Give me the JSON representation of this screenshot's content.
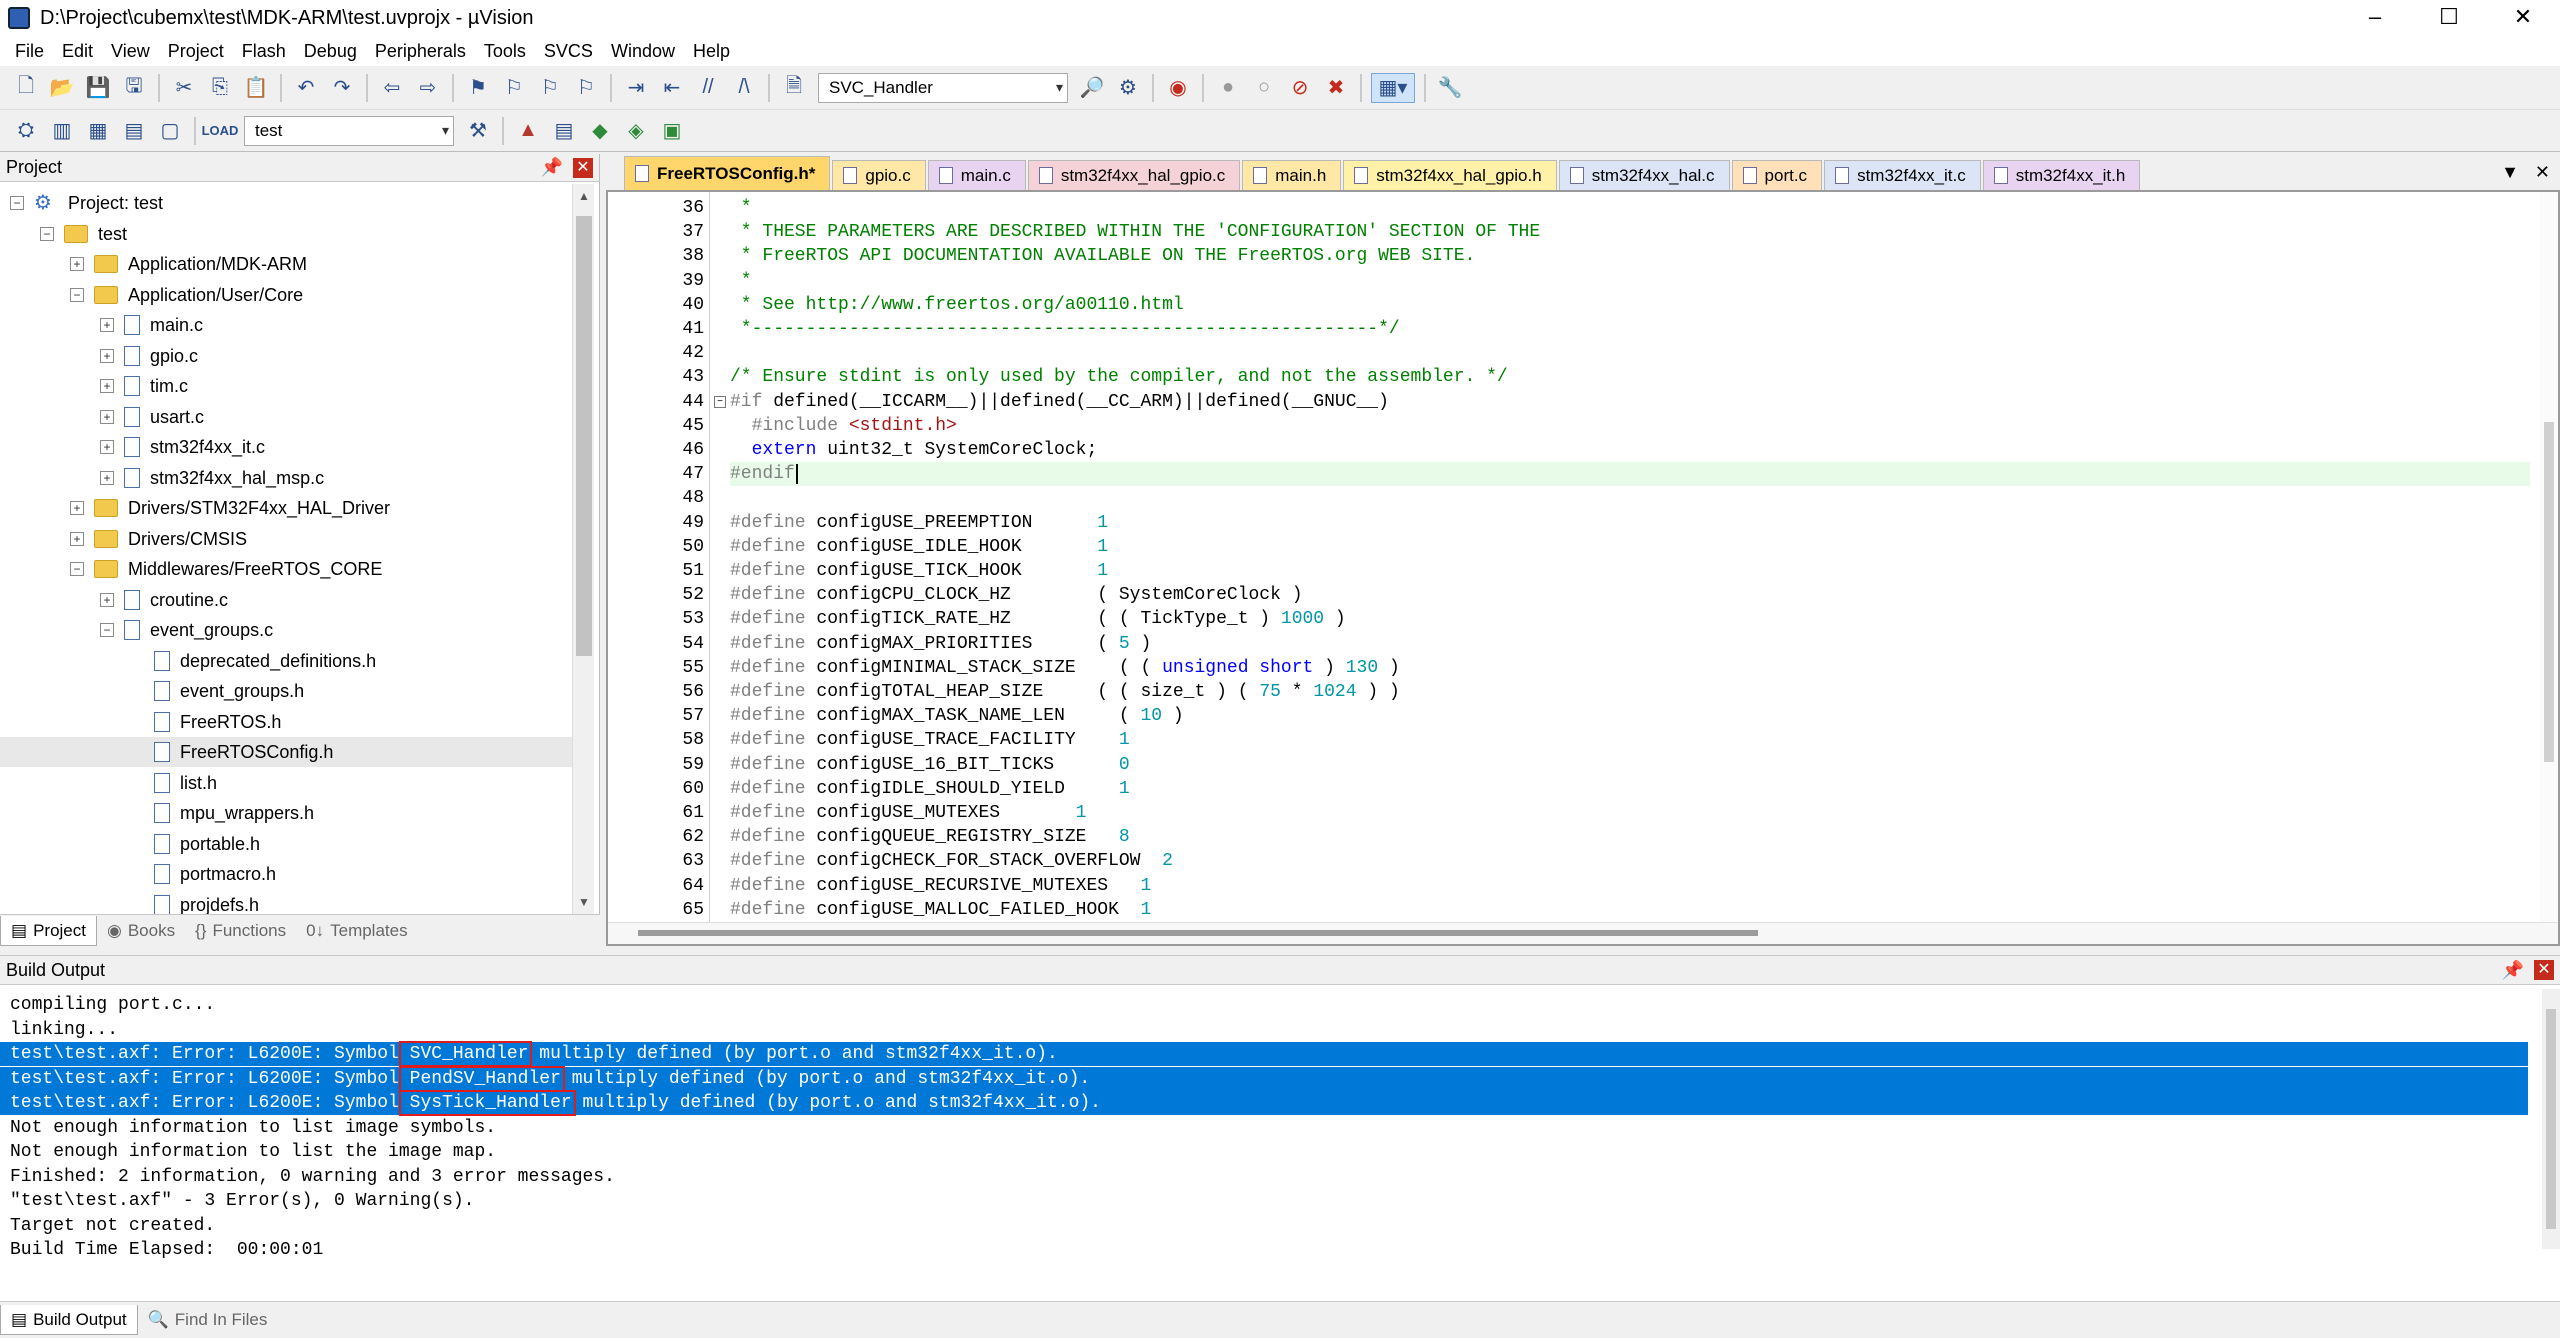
{
  "window": {
    "title": "D:\\Project\\cubemx\\test\\MDK-ARM\\test.uvprojx - µVision",
    "controls": [
      "–",
      "☐",
      "✕"
    ]
  },
  "menubar": [
    "File",
    "Edit",
    "View",
    "Project",
    "Flash",
    "Debug",
    "Peripherals",
    "Tools",
    "SVCS",
    "Window",
    "Help"
  ],
  "toolbar": {
    "function_combo": "SVC_Handler",
    "target_combo": "test"
  },
  "project_pane": {
    "title": "Project",
    "tree": [
      {
        "label": "Project: test",
        "level": 0,
        "toggle": "−",
        "icon": "project"
      },
      {
        "label": "test",
        "level": 1,
        "toggle": "−",
        "icon": "folder"
      },
      {
        "label": "Application/MDK-ARM",
        "level": 2,
        "toggle": "+",
        "icon": "folder"
      },
      {
        "label": "Application/User/Core",
        "level": 2,
        "toggle": "−",
        "icon": "folder"
      },
      {
        "label": "main.c",
        "level": 3,
        "toggle": "+",
        "icon": "file"
      },
      {
        "label": "gpio.c",
        "level": 3,
        "toggle": "+",
        "icon": "file"
      },
      {
        "label": "tim.c",
        "level": 3,
        "toggle": "+",
        "icon": "file"
      },
      {
        "label": "usart.c",
        "level": 3,
        "toggle": "+",
        "icon": "file"
      },
      {
        "label": "stm32f4xx_it.c",
        "level": 3,
        "toggle": "+",
        "icon": "file"
      },
      {
        "label": "stm32f4xx_hal_msp.c",
        "level": 3,
        "toggle": "+",
        "icon": "file"
      },
      {
        "label": "Drivers/STM32F4xx_HAL_Driver",
        "level": 2,
        "toggle": "+",
        "icon": "folder"
      },
      {
        "label": "Drivers/CMSIS",
        "level": 2,
        "toggle": "+",
        "icon": "folder"
      },
      {
        "label": "Middlewares/FreeRTOS_CORE",
        "level": 2,
        "toggle": "−",
        "icon": "folder"
      },
      {
        "label": "croutine.c",
        "level": 3,
        "toggle": "+",
        "icon": "file"
      },
      {
        "label": "event_groups.c",
        "level": 3,
        "toggle": "−",
        "icon": "file"
      },
      {
        "label": "deprecated_definitions.h",
        "level": 4,
        "toggle": "",
        "icon": "file"
      },
      {
        "label": "event_groups.h",
        "level": 4,
        "toggle": "",
        "icon": "file"
      },
      {
        "label": "FreeRTOS.h",
        "level": 4,
        "toggle": "",
        "icon": "file"
      },
      {
        "label": "FreeRTOSConfig.h",
        "level": 4,
        "toggle": "",
        "icon": "file",
        "selected": true
      },
      {
        "label": "list.h",
        "level": 4,
        "toggle": "",
        "icon": "file"
      },
      {
        "label": "mpu_wrappers.h",
        "level": 4,
        "toggle": "",
        "icon": "file"
      },
      {
        "label": "portable.h",
        "level": 4,
        "toggle": "",
        "icon": "file"
      },
      {
        "label": "portmacro.h",
        "level": 4,
        "toggle": "",
        "icon": "file"
      },
      {
        "label": "projdefs.h",
        "level": 4,
        "toggle": "",
        "icon": "file"
      }
    ],
    "tabs": [
      {
        "label": "Project",
        "icon": "▤"
      },
      {
        "label": "Books",
        "icon": "◉"
      },
      {
        "label": "Functions",
        "icon": "{}"
      },
      {
        "label": "Templates",
        "icon": "0↓"
      }
    ]
  },
  "editor": {
    "tabs": [
      {
        "label": "FreeRTOSConfig.h*",
        "color": "#ffd66b",
        "active": true
      },
      {
        "label": "gpio.c",
        "color": "#ffe7a6"
      },
      {
        "label": "main.c",
        "color": "#e8d4f0"
      },
      {
        "label": "stm32f4xx_hal_gpio.c",
        "color": "#f5d2d8"
      },
      {
        "label": "main.h",
        "color": "#ffe7a6"
      },
      {
        "label": "stm32f4xx_hal_gpio.h",
        "color": "#fff2a8"
      },
      {
        "label": "stm32f4xx_hal.c",
        "color": "#dbe5f5"
      },
      {
        "label": "port.c",
        "color": "#ffe0b8"
      },
      {
        "label": "stm32f4xx_it.c",
        "color": "#dbe5f5"
      },
      {
        "label": "stm32f4xx_it.h",
        "color": "#e8d4f0"
      }
    ],
    "lines": [
      {
        "n": "36",
        "t": [
          [
            "c-com",
            " *"
          ]
        ]
      },
      {
        "n": "37",
        "t": [
          [
            "c-com",
            " * THESE PARAMETERS ARE DESCRIBED WITHIN THE 'CONFIGURATION' SECTION OF THE"
          ]
        ]
      },
      {
        "n": "38",
        "t": [
          [
            "c-com",
            " * FreeRTOS API DOCUMENTATION AVAILABLE ON THE FreeRTOS.org WEB SITE."
          ]
        ]
      },
      {
        "n": "39",
        "t": [
          [
            "c-com",
            " *"
          ]
        ]
      },
      {
        "n": "40",
        "t": [
          [
            "c-com",
            " * See http://www.freertos.org/a00110.html"
          ]
        ]
      },
      {
        "n": "41",
        "t": [
          [
            "c-com",
            " *----------------------------------------------------------*/"
          ]
        ]
      },
      {
        "n": "42",
        "t": [
          [
            "c-txt",
            ""
          ]
        ]
      },
      {
        "n": "43",
        "t": [
          [
            "c-com",
            "/* Ensure stdint is only used by the compiler, and not the assembler. */"
          ]
        ]
      },
      {
        "n": "44",
        "t": [
          [
            "c-pp",
            "#if"
          ],
          [
            "c-txt",
            " defined(__ICCARM__)||defined(__CC_ARM)||defined(__GNUC__)"
          ]
        ],
        "fold": true
      },
      {
        "n": "45",
        "t": [
          [
            "c-pp",
            "  #include "
          ],
          [
            "c-str",
            "<stdint.h>"
          ]
        ]
      },
      {
        "n": "46",
        "t": [
          [
            "c-kw",
            "  extern"
          ],
          [
            "c-txt",
            " uint32_t SystemCoreClock;"
          ]
        ]
      },
      {
        "n": "47",
        "t": [
          [
            "c-pp",
            "#endif"
          ]
        ],
        "current": true
      },
      {
        "n": "48",
        "t": [
          [
            "c-txt",
            ""
          ]
        ]
      },
      {
        "n": "49",
        "t": [
          [
            "c-pp",
            "#define"
          ],
          [
            "c-txt",
            " configUSE_PREEMPTION      "
          ],
          [
            "c-num",
            "1"
          ]
        ]
      },
      {
        "n": "50",
        "t": [
          [
            "c-pp",
            "#define"
          ],
          [
            "c-txt",
            " configUSE_IDLE_HOOK       "
          ],
          [
            "c-num",
            "1"
          ]
        ]
      },
      {
        "n": "51",
        "t": [
          [
            "c-pp",
            "#define"
          ],
          [
            "c-txt",
            " configUSE_TICK_HOOK       "
          ],
          [
            "c-num",
            "1"
          ]
        ]
      },
      {
        "n": "52",
        "t": [
          [
            "c-pp",
            "#define"
          ],
          [
            "c-txt",
            " configCPU_CLOCK_HZ        ( SystemCoreClock )"
          ]
        ]
      },
      {
        "n": "53",
        "t": [
          [
            "c-pp",
            "#define"
          ],
          [
            "c-txt",
            " configTICK_RATE_HZ        ( ( TickType_t ) "
          ],
          [
            "c-num",
            "1000"
          ],
          [
            "c-txt",
            " )"
          ]
        ]
      },
      {
        "n": "54",
        "t": [
          [
            "c-pp",
            "#define"
          ],
          [
            "c-txt",
            " configMAX_PRIORITIES      ( "
          ],
          [
            "c-num",
            "5"
          ],
          [
            "c-txt",
            " )"
          ]
        ]
      },
      {
        "n": "55",
        "t": [
          [
            "c-pp",
            "#define"
          ],
          [
            "c-txt",
            " configMINIMAL_STACK_SIZE    ( ( "
          ],
          [
            "c-kw",
            "unsigned short"
          ],
          [
            "c-txt",
            " ) "
          ],
          [
            "c-num",
            "130"
          ],
          [
            "c-txt",
            " )"
          ]
        ]
      },
      {
        "n": "56",
        "t": [
          [
            "c-pp",
            "#define"
          ],
          [
            "c-txt",
            " configTOTAL_HEAP_SIZE     ( ( size_t ) ( "
          ],
          [
            "c-num",
            "75"
          ],
          [
            "c-txt",
            " * "
          ],
          [
            "c-num",
            "1024"
          ],
          [
            "c-txt",
            " ) )"
          ]
        ]
      },
      {
        "n": "57",
        "t": [
          [
            "c-pp",
            "#define"
          ],
          [
            "c-txt",
            " configMAX_TASK_NAME_LEN     ( "
          ],
          [
            "c-num",
            "10"
          ],
          [
            "c-txt",
            " )"
          ]
        ]
      },
      {
        "n": "58",
        "t": [
          [
            "c-pp",
            "#define"
          ],
          [
            "c-txt",
            " configUSE_TRACE_FACILITY    "
          ],
          [
            "c-num",
            "1"
          ]
        ]
      },
      {
        "n": "59",
        "t": [
          [
            "c-pp",
            "#define"
          ],
          [
            "c-txt",
            " configUSE_16_BIT_TICKS      "
          ],
          [
            "c-num",
            "0"
          ]
        ]
      },
      {
        "n": "60",
        "t": [
          [
            "c-pp",
            "#define"
          ],
          [
            "c-txt",
            " configIDLE_SHOULD_YIELD     "
          ],
          [
            "c-num",
            "1"
          ]
        ]
      },
      {
        "n": "61",
        "t": [
          [
            "c-pp",
            "#define"
          ],
          [
            "c-txt",
            " configUSE_MUTEXES       "
          ],
          [
            "c-num",
            "1"
          ]
        ]
      },
      {
        "n": "62",
        "t": [
          [
            "c-pp",
            "#define"
          ],
          [
            "c-txt",
            " configQUEUE_REGISTRY_SIZE   "
          ],
          [
            "c-num",
            "8"
          ]
        ]
      },
      {
        "n": "63",
        "t": [
          [
            "c-pp",
            "#define"
          ],
          [
            "c-txt",
            " configCHECK_FOR_STACK_OVERFLOW  "
          ],
          [
            "c-num",
            "2"
          ]
        ]
      },
      {
        "n": "64",
        "t": [
          [
            "c-pp",
            "#define"
          ],
          [
            "c-txt",
            " configUSE_RECURSIVE_MUTEXES   "
          ],
          [
            "c-num",
            "1"
          ]
        ]
      },
      {
        "n": "65",
        "t": [
          [
            "c-pp",
            "#define"
          ],
          [
            "c-txt",
            " configUSE_MALLOC_FAILED_HOOK  "
          ],
          [
            "c-num",
            "1"
          ]
        ]
      }
    ]
  },
  "build_output": {
    "title": "Build Output",
    "lines": [
      {
        "text": "compiling port.c...",
        "error": false
      },
      {
        "text": "linking...",
        "error": false
      },
      {
        "text": "test\\test.axf: Error: L6200E: Symbol SVC_Handler multiply defined (by port.o and stm32f4xx_it.o).",
        "error": true
      },
      {
        "text": "test\\test.axf: Error: L6200E: Symbol PendSV_Handler multiply defined (by port.o and stm32f4xx_it.o).",
        "error": true
      },
      {
        "text": "test\\test.axf: Error: L6200E: Symbol SysTick_Handler multiply defined (by port.o and stm32f4xx_it.o).",
        "error": true
      },
      {
        "text": "Not enough information to list image symbols.",
        "error": false
      },
      {
        "text": "Not enough information to list the image map.",
        "error": false
      },
      {
        "text": "Finished: 2 information, 0 warning and 3 error messages.",
        "error": false
      },
      {
        "text": "\"test\\test.axf\" - 3 Error(s), 0 Warning(s).",
        "error": false
      },
      {
        "text": "Target not created.",
        "error": false
      },
      {
        "text": "Build Time Elapsed:  00:00:01",
        "error": false
      }
    ],
    "tabs": [
      {
        "label": "Build Output",
        "icon": "▤"
      },
      {
        "label": "Find In Files",
        "icon": "🔍"
      }
    ]
  },
  "colors": {
    "error_highlight": "#0078d7",
    "annotation_box": "#e01b1b",
    "active_tab": "#ffd66b"
  }
}
